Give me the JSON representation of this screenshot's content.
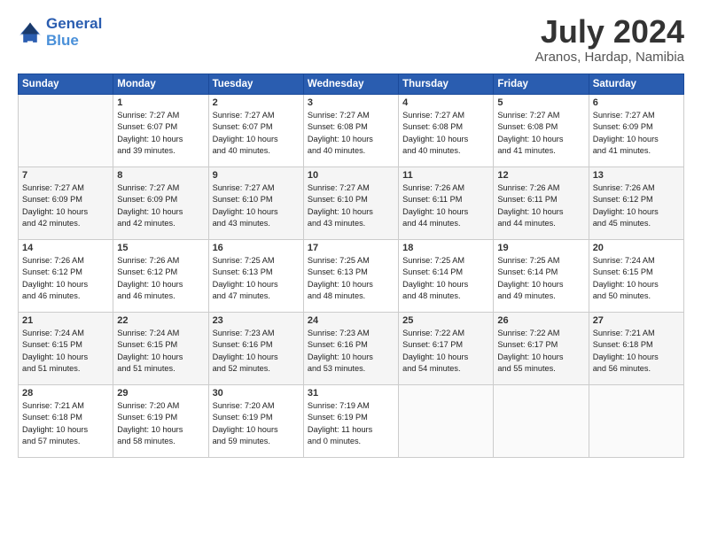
{
  "header": {
    "logo_line1": "General",
    "logo_line2": "Blue",
    "month_title": "July 2024",
    "location": "Aranos, Hardap, Namibia"
  },
  "days_of_week": [
    "Sunday",
    "Monday",
    "Tuesday",
    "Wednesday",
    "Thursday",
    "Friday",
    "Saturday"
  ],
  "weeks": [
    [
      {
        "day": "",
        "text": ""
      },
      {
        "day": "1",
        "text": "Sunrise: 7:27 AM\nSunset: 6:07 PM\nDaylight: 10 hours\nand 39 minutes."
      },
      {
        "day": "2",
        "text": "Sunrise: 7:27 AM\nSunset: 6:07 PM\nDaylight: 10 hours\nand 40 minutes."
      },
      {
        "day": "3",
        "text": "Sunrise: 7:27 AM\nSunset: 6:08 PM\nDaylight: 10 hours\nand 40 minutes."
      },
      {
        "day": "4",
        "text": "Sunrise: 7:27 AM\nSunset: 6:08 PM\nDaylight: 10 hours\nand 40 minutes."
      },
      {
        "day": "5",
        "text": "Sunrise: 7:27 AM\nSunset: 6:08 PM\nDaylight: 10 hours\nand 41 minutes."
      },
      {
        "day": "6",
        "text": "Sunrise: 7:27 AM\nSunset: 6:09 PM\nDaylight: 10 hours\nand 41 minutes."
      }
    ],
    [
      {
        "day": "7",
        "text": "Sunrise: 7:27 AM\nSunset: 6:09 PM\nDaylight: 10 hours\nand 42 minutes."
      },
      {
        "day": "8",
        "text": "Sunrise: 7:27 AM\nSunset: 6:09 PM\nDaylight: 10 hours\nand 42 minutes."
      },
      {
        "day": "9",
        "text": "Sunrise: 7:27 AM\nSunset: 6:10 PM\nDaylight: 10 hours\nand 43 minutes."
      },
      {
        "day": "10",
        "text": "Sunrise: 7:27 AM\nSunset: 6:10 PM\nDaylight: 10 hours\nand 43 minutes."
      },
      {
        "day": "11",
        "text": "Sunrise: 7:26 AM\nSunset: 6:11 PM\nDaylight: 10 hours\nand 44 minutes."
      },
      {
        "day": "12",
        "text": "Sunrise: 7:26 AM\nSunset: 6:11 PM\nDaylight: 10 hours\nand 44 minutes."
      },
      {
        "day": "13",
        "text": "Sunrise: 7:26 AM\nSunset: 6:12 PM\nDaylight: 10 hours\nand 45 minutes."
      }
    ],
    [
      {
        "day": "14",
        "text": "Sunrise: 7:26 AM\nSunset: 6:12 PM\nDaylight: 10 hours\nand 46 minutes."
      },
      {
        "day": "15",
        "text": "Sunrise: 7:26 AM\nSunset: 6:12 PM\nDaylight: 10 hours\nand 46 minutes."
      },
      {
        "day": "16",
        "text": "Sunrise: 7:25 AM\nSunset: 6:13 PM\nDaylight: 10 hours\nand 47 minutes."
      },
      {
        "day": "17",
        "text": "Sunrise: 7:25 AM\nSunset: 6:13 PM\nDaylight: 10 hours\nand 48 minutes."
      },
      {
        "day": "18",
        "text": "Sunrise: 7:25 AM\nSunset: 6:14 PM\nDaylight: 10 hours\nand 48 minutes."
      },
      {
        "day": "19",
        "text": "Sunrise: 7:25 AM\nSunset: 6:14 PM\nDaylight: 10 hours\nand 49 minutes."
      },
      {
        "day": "20",
        "text": "Sunrise: 7:24 AM\nSunset: 6:15 PM\nDaylight: 10 hours\nand 50 minutes."
      }
    ],
    [
      {
        "day": "21",
        "text": "Sunrise: 7:24 AM\nSunset: 6:15 PM\nDaylight: 10 hours\nand 51 minutes."
      },
      {
        "day": "22",
        "text": "Sunrise: 7:24 AM\nSunset: 6:15 PM\nDaylight: 10 hours\nand 51 minutes."
      },
      {
        "day": "23",
        "text": "Sunrise: 7:23 AM\nSunset: 6:16 PM\nDaylight: 10 hours\nand 52 minutes."
      },
      {
        "day": "24",
        "text": "Sunrise: 7:23 AM\nSunset: 6:16 PM\nDaylight: 10 hours\nand 53 minutes."
      },
      {
        "day": "25",
        "text": "Sunrise: 7:22 AM\nSunset: 6:17 PM\nDaylight: 10 hours\nand 54 minutes."
      },
      {
        "day": "26",
        "text": "Sunrise: 7:22 AM\nSunset: 6:17 PM\nDaylight: 10 hours\nand 55 minutes."
      },
      {
        "day": "27",
        "text": "Sunrise: 7:21 AM\nSunset: 6:18 PM\nDaylight: 10 hours\nand 56 minutes."
      }
    ],
    [
      {
        "day": "28",
        "text": "Sunrise: 7:21 AM\nSunset: 6:18 PM\nDaylight: 10 hours\nand 57 minutes."
      },
      {
        "day": "29",
        "text": "Sunrise: 7:20 AM\nSunset: 6:19 PM\nDaylight: 10 hours\nand 58 minutes."
      },
      {
        "day": "30",
        "text": "Sunrise: 7:20 AM\nSunset: 6:19 PM\nDaylight: 10 hours\nand 59 minutes."
      },
      {
        "day": "31",
        "text": "Sunrise: 7:19 AM\nSunset: 6:19 PM\nDaylight: 11 hours\nand 0 minutes."
      },
      {
        "day": "",
        "text": ""
      },
      {
        "day": "",
        "text": ""
      },
      {
        "day": "",
        "text": ""
      }
    ]
  ]
}
